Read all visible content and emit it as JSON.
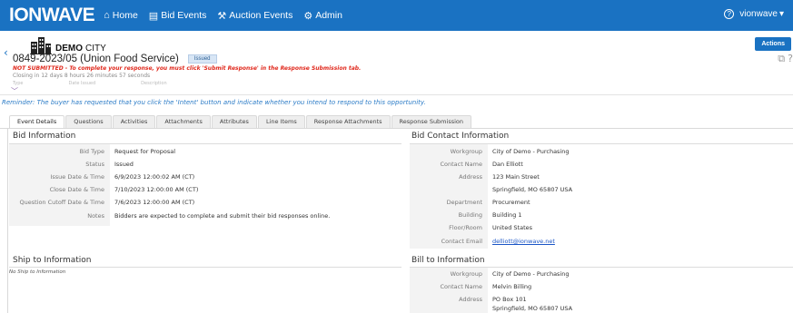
{
  "app": {
    "logo": "IONWAVE",
    "nav": [
      {
        "label": "Home",
        "icon": "home-icon"
      },
      {
        "label": "Bid Events",
        "icon": "document-icon"
      },
      {
        "label": "Auction Events",
        "icon": "gavel-icon"
      },
      {
        "label": "Admin",
        "icon": "gear-icon"
      }
    ],
    "user": "vionwave",
    "user_caret": "▾"
  },
  "header": {
    "org_bold": "DEMO",
    "org_rest": "CITY",
    "title": "0849-2023/05 (Union Food Service)",
    "badge": "Issued",
    "warning": "NOT SUBMITTED - To complete your response, you must click 'Submit Response' in the Response Submission tab.",
    "closing": "Closing in 12 days 8 hours 26 minutes 57 seconds",
    "subcols": [
      "Type",
      "Date Issued",
      "Description"
    ],
    "actions_label": "Actions"
  },
  "reminder": "Reminder: The buyer has requested that you click the 'Intent' button and indicate whether you intend to respond to this opportunity.",
  "tabs": [
    "Event Details",
    "Questions",
    "Activities",
    "Attachments",
    "Attributes",
    "Line Items",
    "Response Attachments",
    "Response Submission"
  ],
  "bid_info": {
    "title": "Bid Information",
    "rows": [
      {
        "k": "Bid Type",
        "v": "Request for Proposal"
      },
      {
        "k": "Status",
        "v": "Issued"
      },
      {
        "k": "Issue Date & Time",
        "v": "6/9/2023 12:00:02 AM (CT)"
      },
      {
        "k": "Close Date & Time",
        "v": "7/10/2023 12:00:00 AM (CT)"
      },
      {
        "k": "Question Cutoff Date & Time",
        "v": "7/6/2023 12:00:00 AM (CT)"
      },
      {
        "k": "Notes",
        "v": "Bidders are expected to complete and submit their bid responses online."
      }
    ]
  },
  "contact": {
    "title": "Bid Contact Information",
    "rows": [
      {
        "k": "Workgroup",
        "v": "City of Demo - Purchasing"
      },
      {
        "k": "Contact Name",
        "v": "Dan Elliott"
      },
      {
        "k": "Address",
        "v": "123 Main Street"
      },
      {
        "k": "",
        "v": "Springfield, MO 65807 USA"
      },
      {
        "k": "Department",
        "v": "Procurement"
      },
      {
        "k": "Building",
        "v": "Building 1"
      },
      {
        "k": "Floor/Room",
        "v": "United States"
      },
      {
        "k": "Contact Email",
        "v": "delliott@ionwave.net"
      }
    ]
  },
  "ship": {
    "title": "Ship to Information",
    "empty": "No Ship to Information"
  },
  "bill": {
    "title": "Bill to Information",
    "rows": [
      {
        "k": "Workgroup",
        "v": "City of Demo - Purchasing"
      },
      {
        "k": "Contact Name",
        "v": "Melvin Billing"
      },
      {
        "k": "Address",
        "v": "PO Box 101"
      },
      {
        "k": "",
        "v": "Springfield, MO 65807 USA"
      }
    ]
  }
}
